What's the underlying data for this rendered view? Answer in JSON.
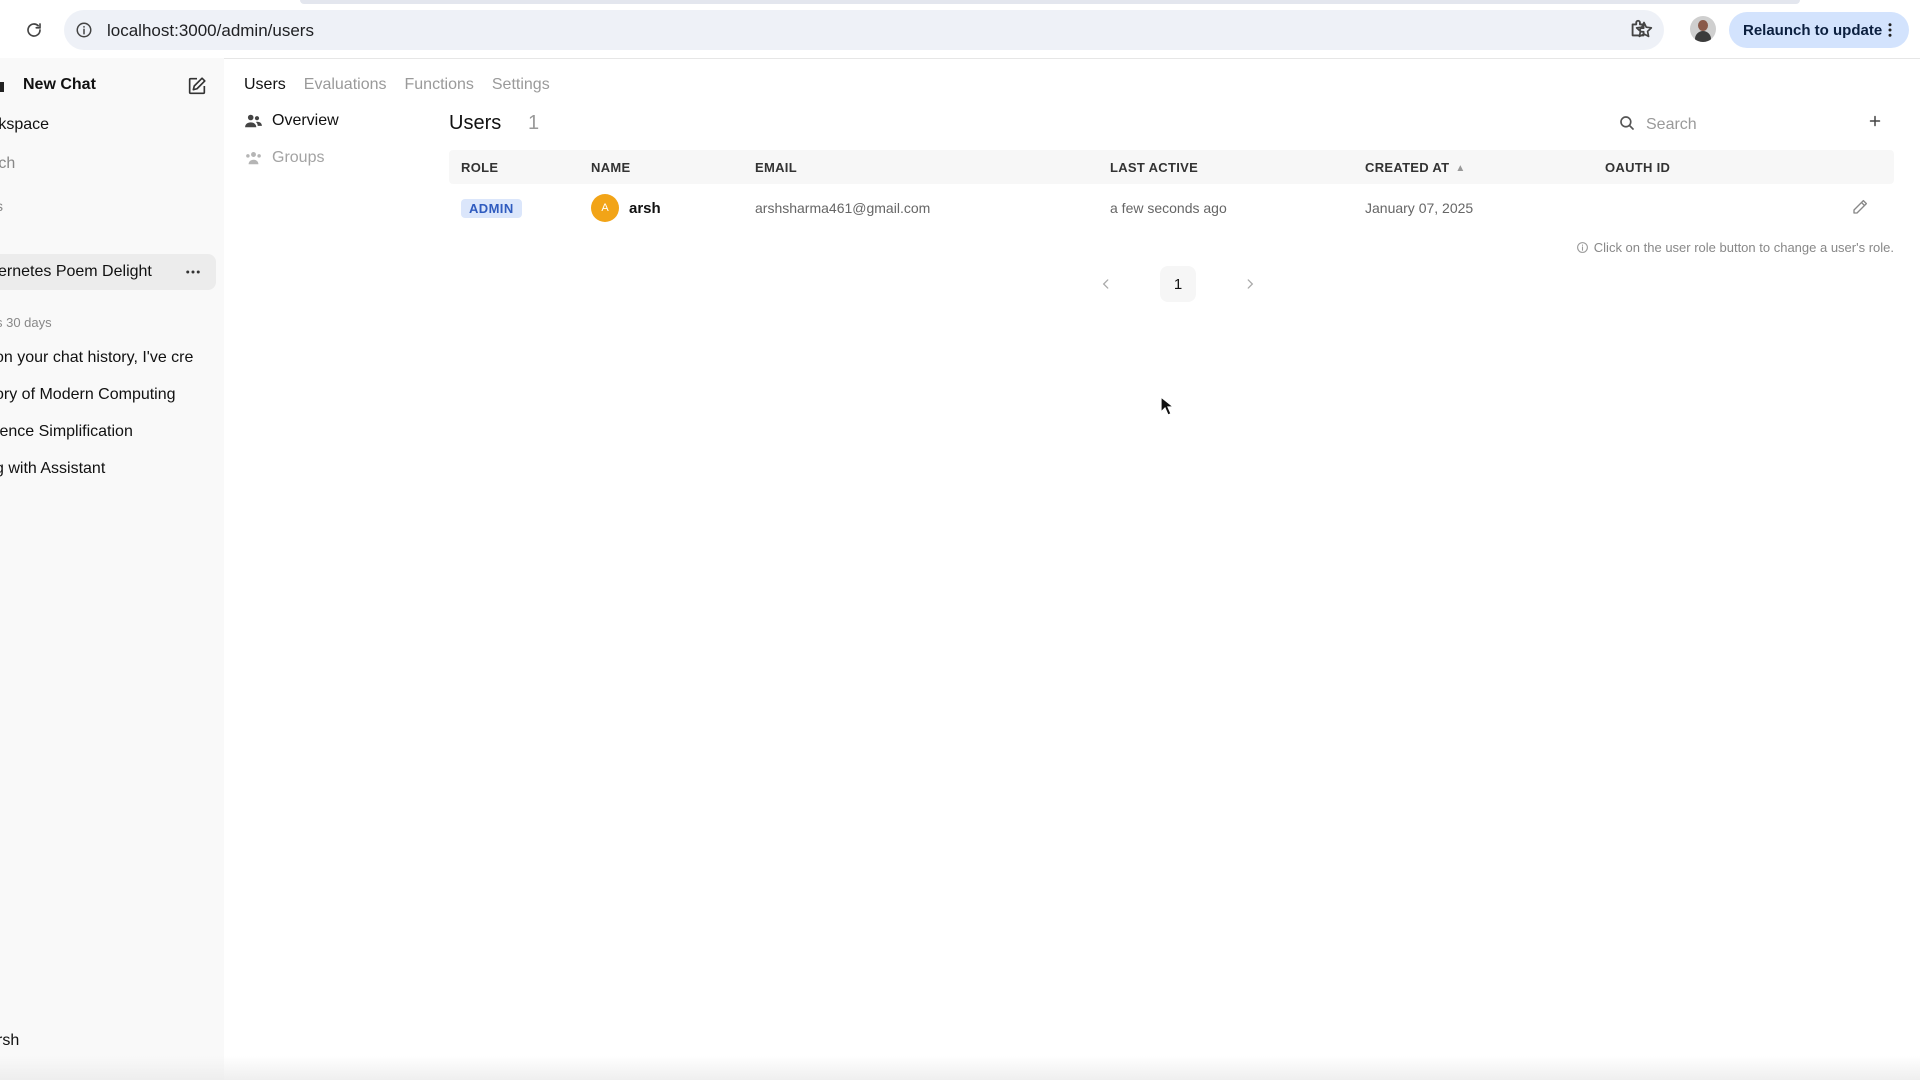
{
  "browser": {
    "url": "localhost:3000/admin/users",
    "relaunch_label": "Relaunch to update"
  },
  "sidebar": {
    "new_chat": "New Chat",
    "workspace": "rkspace",
    "search": "rch",
    "section_s": "s",
    "active_chat": "ernetes Poem Delight",
    "section_label": "s 30 days",
    "chats": [
      "on your chat history, I've cre",
      "ory of Modern Computing",
      "tence Simplification",
      "g with Assistant"
    ],
    "user": "rsh"
  },
  "admin": {
    "tabs": [
      "Users",
      "Evaluations",
      "Functions",
      "Settings"
    ],
    "subnav": [
      "Overview",
      "Groups"
    ],
    "users_title": "Users",
    "users_count": "1",
    "search_placeholder": "Search",
    "columns": [
      "ROLE",
      "NAME",
      "EMAIL",
      "LAST ACTIVE",
      "CREATED AT",
      "OAUTH ID"
    ],
    "rows": [
      {
        "role": "ADMIN",
        "avatar_initial": "A",
        "name": "arsh",
        "email": "arshsharma461@gmail.com",
        "last_active": "a few seconds ago",
        "created_at": "January 07, 2025",
        "oauth_id": ""
      }
    ],
    "hint": "Click on the user role button to change a user's role.",
    "page": "1"
  },
  "colors": {
    "role_badge_bg": "#dbe6fb",
    "role_badge_text": "#2f5bbf",
    "avatar_bg": "#f2a417",
    "relaunch_bg": "#d3e3fd"
  }
}
